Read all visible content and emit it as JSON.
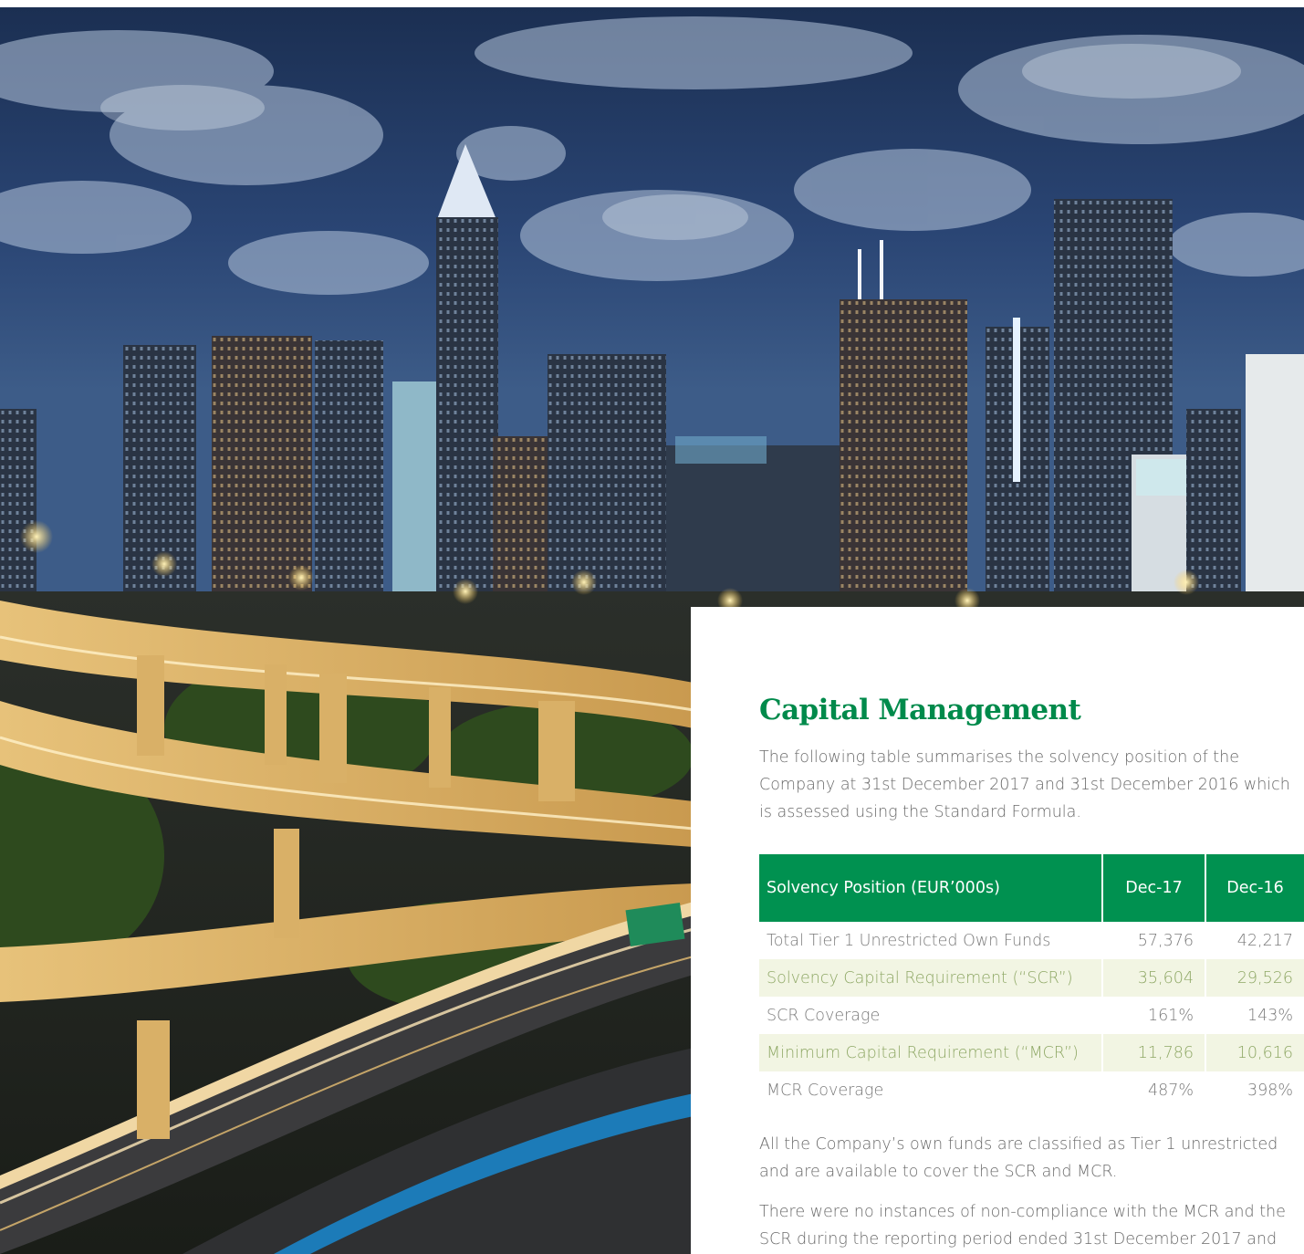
{
  "section": {
    "title": "Capital Management",
    "intro": "The following table summarises the solvency position of the Company at 31st December 2017 and 31st December 2016 which is assessed using the Standard Formula.",
    "note_1": "All the Company’s own funds are classified as Tier 1 unrestricted and are available to cover the SCR and MCR.",
    "note_2": "There were no instances of non-compliance with the MCR and the SCR during the reporting period ended 31st December 2017 and"
  },
  "table": {
    "headers": [
      "Solvency Position (EUR’000s)",
      "Dec-17",
      "Dec-16"
    ],
    "rows": [
      {
        "label": "Total Tier 1 Unrestricted Own Funds",
        "dec17": "57,376",
        "dec16": "42,217"
      },
      {
        "label": "Solvency Capital Requirement (“SCR”)",
        "dec17": "35,604",
        "dec16": "29,526"
      },
      {
        "label": "SCR Coverage",
        "dec17": "161%",
        "dec16": "143%"
      },
      {
        "label": "Minimum Capital Requirement (“MCR”)",
        "dec17": "11,786",
        "dec16": "10,616"
      },
      {
        "label": "MCR Coverage",
        "dec17": "487%",
        "dec16": "398%"
      }
    ]
  },
  "colors": {
    "brand_green": "#009150",
    "heading_green": "#008a4b",
    "row_shade": "#f2f5e3"
  }
}
